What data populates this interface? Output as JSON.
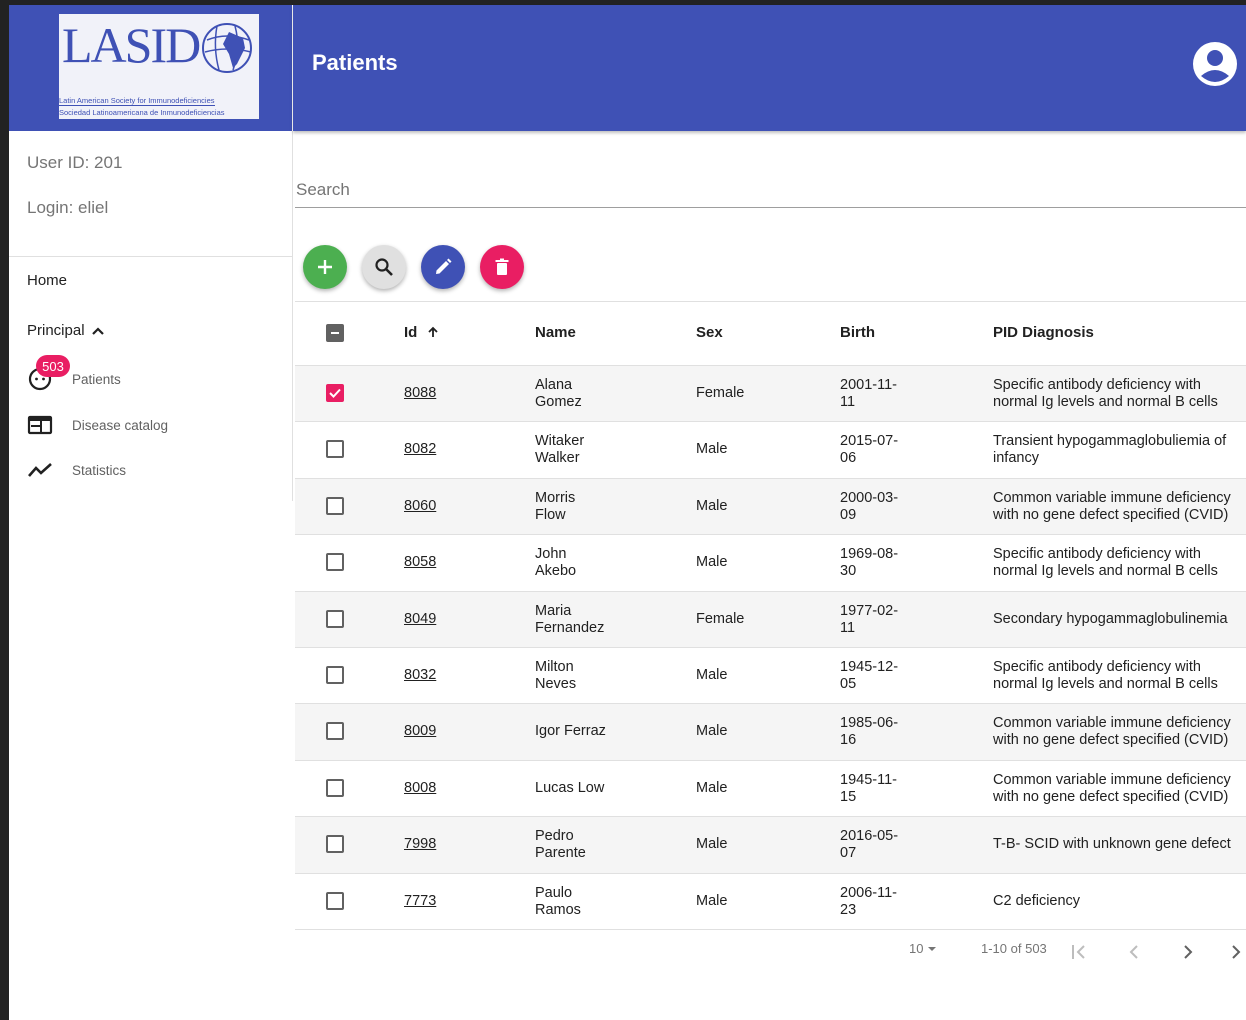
{
  "logo": {
    "text": "LASID",
    "subtitle1": "Latin American Society for Immunodeficiencies",
    "subtitle2": "Sociedad Latinoamericana de Inmunodeficiencias"
  },
  "user": {
    "id_label": "User ID: 201",
    "login_label": "Login: eliel"
  },
  "nav": {
    "home": "Home",
    "principal": "Principal",
    "patients": "Patients",
    "patients_badge": "503",
    "disease_catalog": "Disease catalog",
    "statistics": "Statistics"
  },
  "header": {
    "title": "Patients"
  },
  "search": {
    "placeholder": "Search",
    "value": ""
  },
  "colors": {
    "primary": "#3f51b5",
    "accent": "#e91e63",
    "add": "#4caf50",
    "edit": "#3f51b5",
    "delete": "#e91e63"
  },
  "table": {
    "columns": {
      "id": "Id",
      "name": "Name",
      "sex": "Sex",
      "birth": "Birth",
      "diagnosis": "PID Diagnosis"
    },
    "rows": [
      {
        "id": "8088",
        "name1": "Alana",
        "name2": "Gomez",
        "sex": "Female",
        "birth1": "2001-11-",
        "birth2": "11",
        "diag1": "Specific antibody deficiency with",
        "diag2": "normal Ig levels and normal B cells",
        "checked": true
      },
      {
        "id": "8082",
        "name1": "Witaker",
        "name2": "Walker",
        "sex": "Male",
        "birth1": "2015-07-",
        "birth2": "06",
        "diag1": "Transient hypogammaglobuliemia of",
        "diag2": "infancy",
        "checked": false
      },
      {
        "id": "8060",
        "name1": "Morris",
        "name2": "Flow",
        "sex": "Male",
        "birth1": "2000-03-",
        "birth2": "09",
        "diag1": "Common variable immune deficiency",
        "diag2": "with no gene defect specified (CVID)",
        "checked": false
      },
      {
        "id": "8058",
        "name1": "John",
        "name2": "Akebo",
        "sex": "Male",
        "birth1": "1969-08-",
        "birth2": "30",
        "diag1": "Specific antibody deficiency with",
        "diag2": "normal Ig levels and normal B cells",
        "checked": false
      },
      {
        "id": "8049",
        "name1": "Maria",
        "name2": "Fernandez",
        "sex": "Female",
        "birth1": "1977-02-",
        "birth2": "11",
        "diag1": "Secondary hypogammaglobulinemia",
        "diag2": "",
        "checked": false
      },
      {
        "id": "8032",
        "name1": "Milton",
        "name2": "Neves",
        "sex": "Male",
        "birth1": "1945-12-",
        "birth2": "05",
        "diag1": "Specific antibody deficiency with",
        "diag2": "normal Ig levels and normal B cells",
        "checked": false
      },
      {
        "id": "8009",
        "name1": "Igor Ferraz",
        "name2": "",
        "sex": "Male",
        "birth1": "1985-06-",
        "birth2": "16",
        "diag1": "Common variable immune deficiency",
        "diag2": "with no gene defect specified (CVID)",
        "checked": false
      },
      {
        "id": "8008",
        "name1": "Lucas Low",
        "name2": "",
        "sex": "Male",
        "birth1": "1945-11-",
        "birth2": "15",
        "diag1": "Common variable immune deficiency",
        "diag2": "with no gene defect specified (CVID)",
        "checked": false
      },
      {
        "id": "7998",
        "name1": "Pedro",
        "name2": "Parente",
        "sex": "Male",
        "birth1": "2016-05-",
        "birth2": "07",
        "diag1": "T-B- SCID with unknown gene defect",
        "diag2": "",
        "checked": false
      },
      {
        "id": "7773",
        "name1": "Paulo",
        "name2": "Ramos",
        "sex": "Male",
        "birth1": "2006-11-",
        "birth2": "23",
        "diag1": "C2 deficiency",
        "diag2": "",
        "checked": false
      }
    ]
  },
  "pagination": {
    "rows_per_page": "10",
    "range": "1-10 of 503"
  }
}
